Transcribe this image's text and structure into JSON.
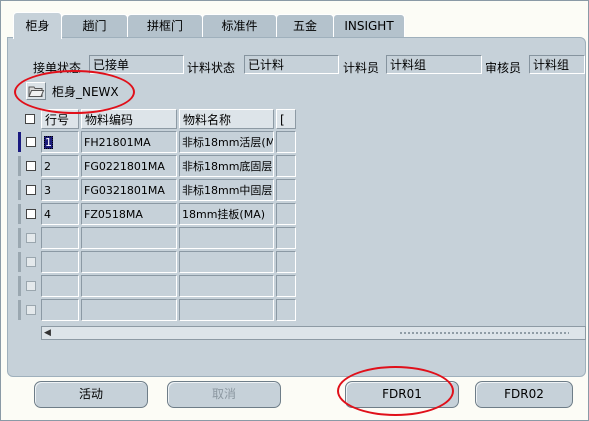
{
  "tabs": [
    {
      "label": "柜身",
      "active": true
    },
    {
      "label": "趟门",
      "active": false
    },
    {
      "label": "拼框门",
      "active": false
    },
    {
      "label": "标准件",
      "active": false
    },
    {
      "label": "五金",
      "active": false
    },
    {
      "label": "INSIGHT",
      "active": false
    }
  ],
  "status_row": {
    "order_status_label": "接单状态",
    "order_status_value": "已接单",
    "costing_status_label": "计料状态",
    "costing_status_value": "已计料",
    "costing_clerk_label": "计料员",
    "costing_clerk_value": "计料组",
    "reviewer_label": "审核员",
    "reviewer_value": "计料组"
  },
  "folder": {
    "icon": "folder-open-icon",
    "label": "柜身_NEWX"
  },
  "grid": {
    "columns": [
      "行号",
      "物料编码",
      "物料名称",
      "["
    ],
    "rows": [
      {
        "line": "1",
        "code": "FH21801MA",
        "name": "非标18mm活层(M"
      },
      {
        "line": "2",
        "code": "FG0221801MA",
        "name": "非标18mm底固层"
      },
      {
        "line": "3",
        "code": "FG0321801MA",
        "name": "非标18mm中固层"
      },
      {
        "line": "4",
        "code": "FZ0518MA",
        "name": "18mm挂板(MA)"
      },
      {
        "line": "",
        "code": "",
        "name": ""
      },
      {
        "line": "",
        "code": "",
        "name": ""
      },
      {
        "line": "",
        "code": "",
        "name": ""
      },
      {
        "line": "",
        "code": "",
        "name": ""
      }
    ]
  },
  "buttons": {
    "activity": "活动",
    "cancel": "取消",
    "fdr01": "FDR01",
    "fdr02": "FDR02"
  },
  "colors": {
    "panel": "#c6d1d9",
    "annotation_circle": "#e0101a",
    "current_row_marker": "#1a1a80"
  }
}
